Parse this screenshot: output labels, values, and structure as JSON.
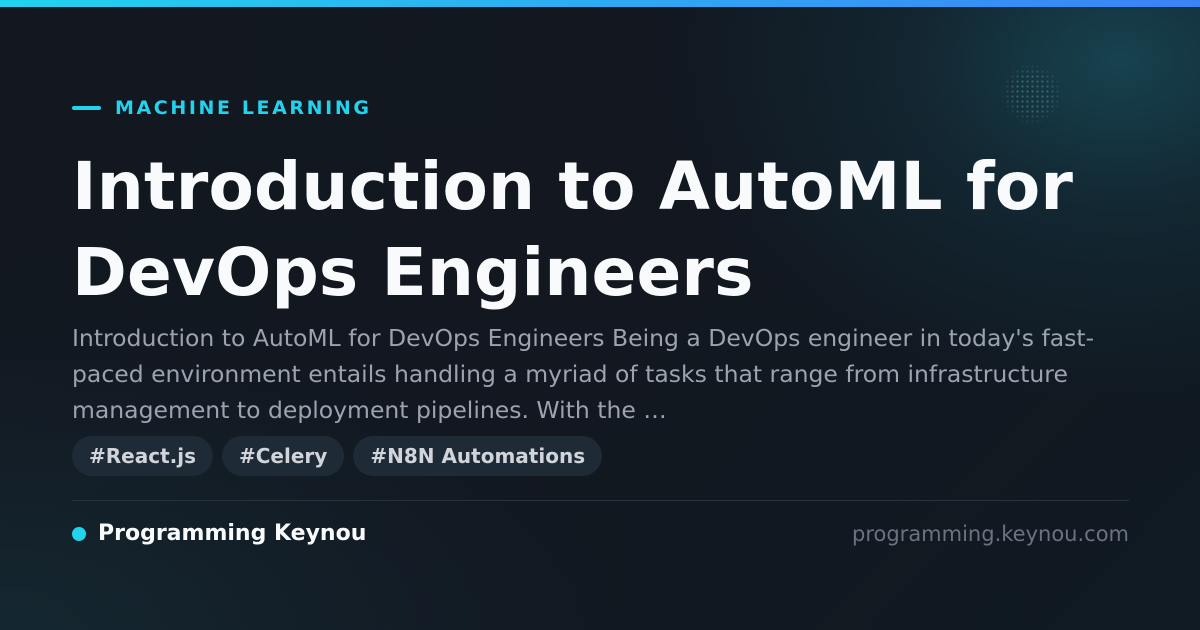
{
  "card": {
    "category": "MACHINE LEARNING",
    "title": "Introduction to AutoML for DevOps Engineers",
    "excerpt": "Introduction to AutoML for DevOps Engineers Being a DevOps engineer in today's fast-paced environment entails handling a myriad of tasks that range from infrastructure management to deployment pipelines. With the …",
    "tags": [
      "#React.js",
      "#Celery",
      "#N8N Automations"
    ]
  },
  "footer": {
    "brand": "Programming Keynou",
    "url": "programming.keynou.com"
  },
  "colors": {
    "accent": "#22d3ee",
    "accent_gradient_end": "#3b82f6",
    "background": "#11151c",
    "title": "#f8fafc",
    "excerpt": "#9ca3af",
    "tag_background": "#1e2a36",
    "tag_text": "#d1d5db",
    "url": "#6b7280"
  },
  "icons": {
    "category_marker": "dash-icon",
    "brand_marker": "dot-icon",
    "decoration": "dot-pattern"
  }
}
